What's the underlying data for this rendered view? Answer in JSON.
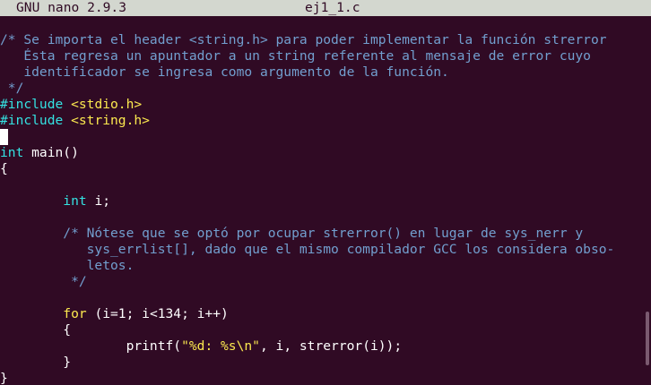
{
  "titlebar": {
    "app": "GNU nano 2.9.3",
    "filename": "ej1_1.c"
  },
  "code": {
    "comment1_l1": "/* Se importa el header <string.h> para poder implementar la función strerror",
    "comment1_l2": "   Ésta regresa un apuntador a un string referente al mensaje de error cuyo",
    "comment1_l3": "   identificador se ingresa como argumento de la función.",
    "comment1_l4": " */",
    "pp_include": "#include",
    "inc_stdio": " <stdio.h>",
    "inc_string": " <string.h>",
    "type_int": "int",
    "main_sig": " main()",
    "open_brace": "{",
    "decl_indent": "        ",
    "decl_rest": " i;",
    "comment2_l1": "        /* Nótese que se optó por ocupar strerror() en lugar de sys_nerr y",
    "comment2_l2": "           sys_errlist[], dado que el mismo compilador GCC los considera obso-",
    "comment2_l3": "           letos.",
    "comment2_l4": "         */",
    "for_indent": "        ",
    "kw_for": "for",
    "for_rest": " (i=1; i<134; i++)",
    "inner_open": "        {",
    "printf_pre": "                printf(",
    "printf_fmt": "\"%d: %s\\n\"",
    "printf_post": ", i, strerror(i));",
    "inner_close": "        }",
    "close_brace": "}"
  },
  "colors": {
    "background": "#300a24",
    "comment": "#729fcf",
    "preprocessor": "#34e2e2",
    "include_path": "#fce94f",
    "keyword": "#fce94f",
    "titlebar": "#d3d7cf"
  }
}
